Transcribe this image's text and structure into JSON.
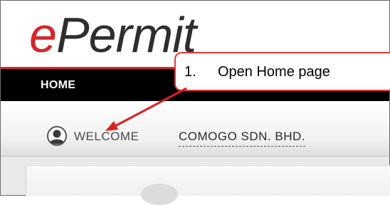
{
  "logo": {
    "e": "e",
    "rest": "Permit"
  },
  "nav": {
    "home_label": "HOME"
  },
  "welcome": {
    "label": "WELCOME",
    "company": "COMOGO SDN. BHD."
  },
  "annotation": {
    "number": "1.",
    "text": "Open Home page"
  },
  "colors": {
    "brand_red": "#d4262c",
    "nav_black": "#000000",
    "callout_border": "#e03a3a"
  },
  "icons": {
    "user": "user-avatar-icon"
  }
}
